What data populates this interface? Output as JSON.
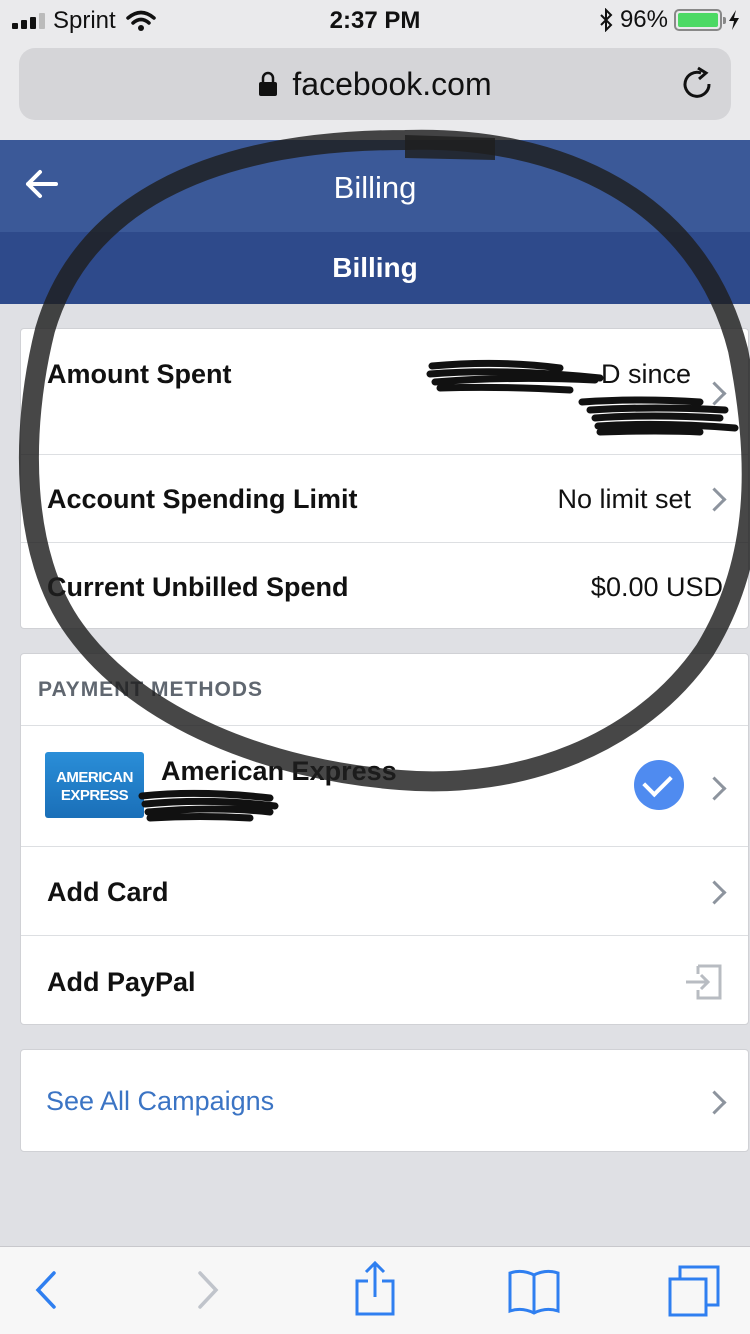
{
  "status_bar": {
    "carrier": "Sprint",
    "time": "2:37 PM",
    "battery": "96%",
    "battery_level": 0.96,
    "icons": [
      "signal-icon",
      "wifi-icon",
      "bluetooth-icon",
      "battery-icon",
      "charging-icon"
    ]
  },
  "browser": {
    "url": "facebook.com",
    "icons": [
      "lock-icon",
      "reload-icon"
    ]
  },
  "header": {
    "title": "Billing",
    "subtitle": "Billing",
    "back_icon": "back-arrow-icon",
    "color": "#3b5998",
    "sub_color": "#2e4a8b"
  },
  "billing_summary": {
    "rows": [
      {
        "label": "Amount Spent",
        "value": "D since"
      },
      {
        "label": "Account Spending Limit",
        "value": "No limit set"
      },
      {
        "label": "Current Unbilled Spend",
        "value": "$0.00 USD"
      }
    ]
  },
  "payment_methods": {
    "header": "PAYMENT METHODS",
    "card": {
      "name": "American Express",
      "logo_line1": "AMERICAN",
      "logo_line2": "EXPRESS",
      "selected": true
    },
    "actions": [
      {
        "label": "Add Card"
      },
      {
        "label": "Add PayPal"
      }
    ]
  },
  "campaigns": {
    "link": "See All Campaigns",
    "link_color": "#3b74c4"
  },
  "safari_toolbar": {
    "icons": [
      "back-icon",
      "forward-icon",
      "share-icon",
      "bookmarks-icon",
      "tabs-icon"
    ],
    "tint": "#2f7ff0"
  }
}
